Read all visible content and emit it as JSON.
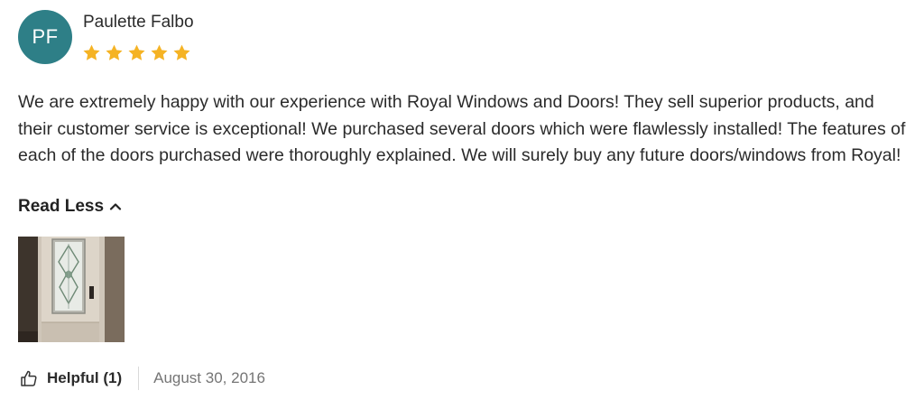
{
  "review": {
    "author_initials": "PF",
    "author_name": "Paulette Falbo",
    "rating": 5,
    "rating_max": 5,
    "body": "We are extremely happy with our experience with Royal Windows and Doors! They sell superior products, and their customer service is exceptional! We purchased several doors which were flawlessly installed! The features of each of the doors purchased were thoroughly explained. We will surely buy any future doors/windows from Royal!",
    "toggle_label": "Read Less",
    "helpful_label": "Helpful (1)",
    "date": "August 30, 2016"
  },
  "icons": {
    "star": "star-icon",
    "toggle": "chevron-up-icon",
    "helpful": "thumbs-up-icon"
  },
  "colors": {
    "avatar_bg": "#2e7f87",
    "star": "#f5b324",
    "text": "#2b2b2b",
    "muted": "#757575"
  }
}
